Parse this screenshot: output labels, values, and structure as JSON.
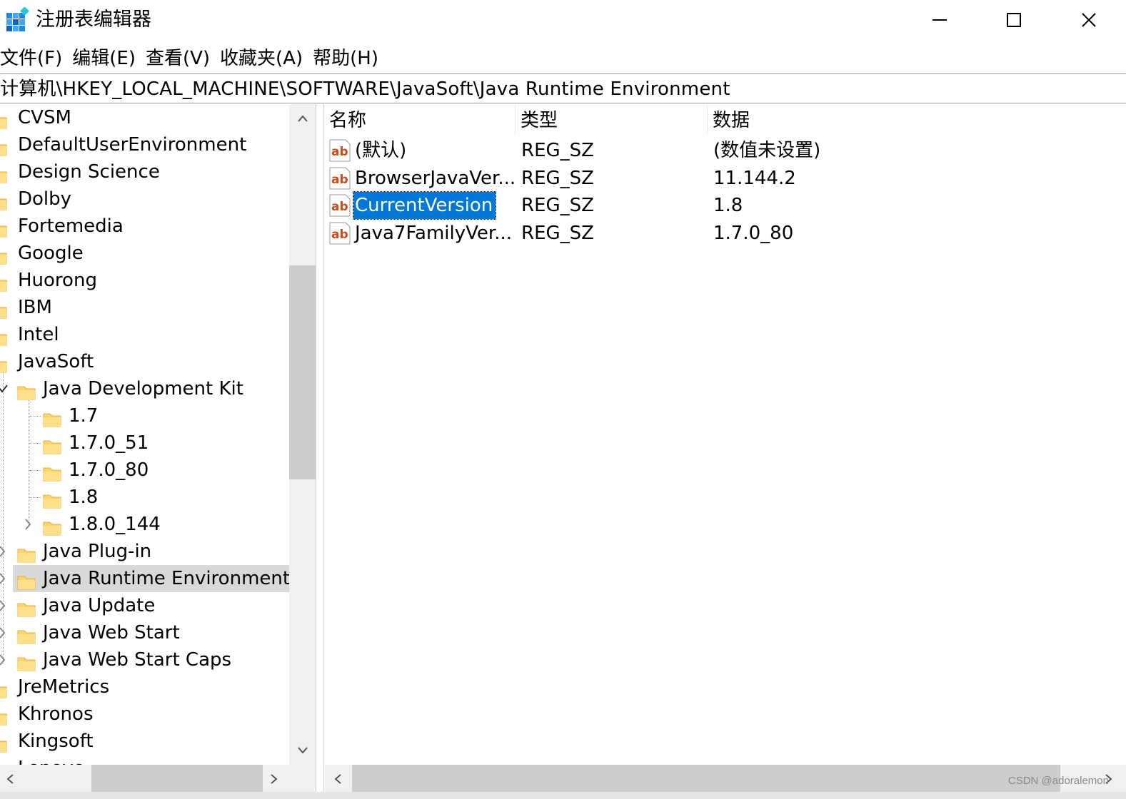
{
  "window": {
    "title": "注册表编辑器",
    "icon": "regedit-icon",
    "controls": {
      "minimize": "minimize-icon",
      "maximize": "maximize-icon",
      "close": "close-icon"
    }
  },
  "menu": [
    "文件(F)",
    "编辑(E)",
    "查看(V)",
    "收藏夹(A)",
    "帮助(H)"
  ],
  "address": "计算机\\HKEY_LOCAL_MACHINE\\SOFTWARE\\JavaSoft\\Java Runtime Environment",
  "tree": {
    "items": [
      {
        "label": "CVSM"
      },
      {
        "label": "DefaultUserEnvironment"
      },
      {
        "label": "Design Science"
      },
      {
        "label": "Dolby"
      },
      {
        "label": "Fortemedia"
      },
      {
        "label": "Google"
      },
      {
        "label": "Huorong"
      },
      {
        "label": "IBM"
      },
      {
        "label": "Intel"
      },
      {
        "label": "JavaSoft"
      },
      {
        "label": "Java Development Kit"
      },
      {
        "label": "1.7"
      },
      {
        "label": "1.7.0_51"
      },
      {
        "label": "1.7.0_80"
      },
      {
        "label": "1.8"
      },
      {
        "label": "1.8.0_144"
      },
      {
        "label": "Java Plug-in"
      },
      {
        "label": "Java Runtime Environment",
        "selected": true
      },
      {
        "label": "Java Update"
      },
      {
        "label": "Java Web Start"
      },
      {
        "label": "Java Web Start Caps"
      },
      {
        "label": "JreMetrics"
      },
      {
        "label": "Khronos"
      },
      {
        "label": "Kingsoft"
      },
      {
        "label": "Lenovo"
      }
    ]
  },
  "values": {
    "columns": [
      "名称",
      "类型",
      "数据"
    ],
    "rows": [
      {
        "name": "(默认)",
        "type": "REG_SZ",
        "data": "(数值未设置)"
      },
      {
        "name": "BrowserJavaVer...",
        "type": "REG_SZ",
        "data": "11.144.2"
      },
      {
        "name": "CurrentVersion",
        "type": "REG_SZ",
        "data": "1.8",
        "selected": true
      },
      {
        "name": "Java7FamilyVer...",
        "type": "REG_SZ",
        "data": "1.7.0_80"
      }
    ]
  },
  "colors": {
    "folder": "#ffd56a",
    "selection": "#0078d7",
    "tree_selection": "#d9d9d9"
  },
  "watermark": "CSDN @adoralemon"
}
